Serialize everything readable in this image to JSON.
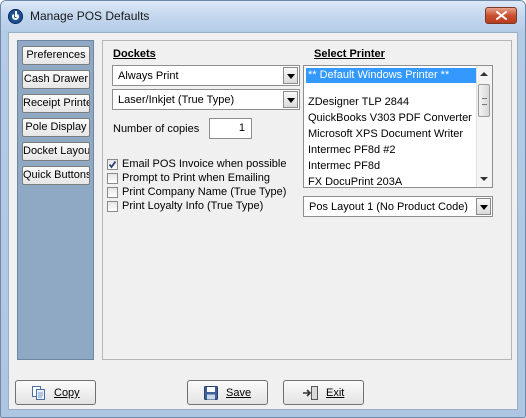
{
  "window": {
    "title": "Manage POS Defaults"
  },
  "sidebar": {
    "items": [
      {
        "label": "Preferences"
      },
      {
        "label": "Cash Drawer"
      },
      {
        "label": "Receipt Printer"
      },
      {
        "label": "Pole Display"
      },
      {
        "label": "Docket Layout"
      },
      {
        "label": "Quick Buttons"
      }
    ]
  },
  "dockets": {
    "heading": "Dockets",
    "print_mode": "Always Print",
    "printer_type": "Laser/Inkjet (True Type)",
    "copies_label": "Number of copies",
    "copies_value": "1",
    "options": [
      {
        "label": "Email POS Invoice when possible",
        "checked": true
      },
      {
        "label": "Prompt to Print when Emailing",
        "checked": false
      },
      {
        "label": "Print Company Name (True Type)",
        "checked": false
      },
      {
        "label": "Print Loyalty Info (True Type)",
        "checked": false
      }
    ]
  },
  "printer": {
    "heading": "Select Printer",
    "selected": "** Default Windows Printer **",
    "list": [
      "** Default Windows Printer **",
      "",
      "ZDesigner TLP 2844",
      "QuickBooks V303 PDF Converter",
      "Microsoft XPS Document Writer",
      "Intermec PF8d #2",
      "Intermec PF8d",
      "FX DocuPrint 203A"
    ],
    "layout": "Pos Layout 1 (No Product Code)"
  },
  "footer": {
    "copy_label": "Copy",
    "save_label": "Save",
    "exit_label": "Exit"
  },
  "colors": {
    "selection": "#3399ff",
    "sidebar": "#8fa8c4",
    "close_button": "#c9502f"
  }
}
